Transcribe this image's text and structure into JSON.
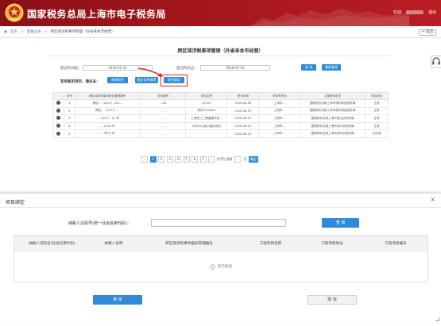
{
  "header": {
    "site_title": "国家税务总局上海市电子税务局",
    "welcome": "欢迎",
    "logout": "退出"
  },
  "breadcrumb": {
    "home": "首页",
    "level1": "套餐业务",
    "current": "跨区域涉税事项管理（外省来本市经营）",
    "back": "返回"
  },
  "main": {
    "title": "跨区域涉税事项管理（外省来本市经营）",
    "date_from_label": "登记时间起：",
    "date_from_value": "2016-01-01",
    "date_to_label": "登记时间止：",
    "date_to_value": "2018-07-01",
    "query_button": "查 询",
    "reset_button": "重新查询",
    "prompt": "若有新的项目，请点击：",
    "new_project_button": "新增项目",
    "modify_project_button": "报告信息修改",
    "bind_project_button": "项目绑定",
    "table": {
      "columns": [
        "",
        "序号",
        "跨区域涉税事项报告管理编号",
        "项目编号",
        "项目名称",
        "登记时间",
        "项目所在地",
        "主管税务机关",
        "项目状态"
      ],
      "rows": [
        {
          "index": "1",
          "report_no": "跨区...（2017）525...",
          "project_no": "...44",
          "name": "21321",
          "date": "2016-06-28",
          "location": "上海市...",
          "tax_office": "国家税务总局上海市浦东新区税务局",
          "status": "正常"
        },
        {
          "index": "2",
          "report_no": "跨区...（2017）...",
          "project_no": "...",
          "name": "测试2018001",
          "date": "2018-06-19",
          "location": "上海市...",
          "tax_office": "国家税务总局上海市浦东新区税务局",
          "status": "正常"
        },
        {
          "index": "3",
          "report_no": "...（2017）21 号",
          "project_no": "...",
          "name": "上海亚江二期道路开拓...",
          "date": "2018-06-19",
          "location": "上海市...",
          "tax_office": "国家税务总局上海市宝山区税务局",
          "status": "正常"
        },
        {
          "index": "4",
          "report_no": "... 1526 号",
          "project_no": "...",
          "name": "中环中心核心建设项目",
          "date": "2018-06-19",
          "location": "上海市...",
          "tax_office": "国家税务总局上海市闵行区税务局",
          "status": "正常"
        },
        {
          "index": "5",
          "report_no": "... 3879 号",
          "project_no": "...",
          "name": "",
          "date": "2018-06-19",
          "location": "上海市...",
          "tax_office": "国家税务总局上海市闵行区税务局",
          "status": "已反馈"
        }
      ]
    },
    "pager": {
      "pages": [
        "1",
        "2",
        "3",
        "4",
        "5",
        "6",
        "7"
      ],
      "active": "1",
      "summary": "共7页 到第",
      "page_unit": "页",
      "go": "确定"
    }
  },
  "dialog": {
    "title": "项目绑定",
    "close": "×",
    "taxpayer_label": "纳税人识别号(统一社会信用代码)：",
    "taxpayer_value": "",
    "search_button": "查 询",
    "columns": [
      "纳税人识别号(社会信用代码)",
      "纳税人名称",
      "跨区域涉税事项报验管理编号",
      "工程项目名称",
      "工程项目地址",
      "工程项目编号"
    ],
    "empty_text": "暂无数据",
    "bind_button": "绑 定",
    "cancel_button": "取 消"
  },
  "colors": {
    "header_red": "#a4161d",
    "accent_blue": "#2f8bd8",
    "highlight_red": "#d42a2a"
  }
}
